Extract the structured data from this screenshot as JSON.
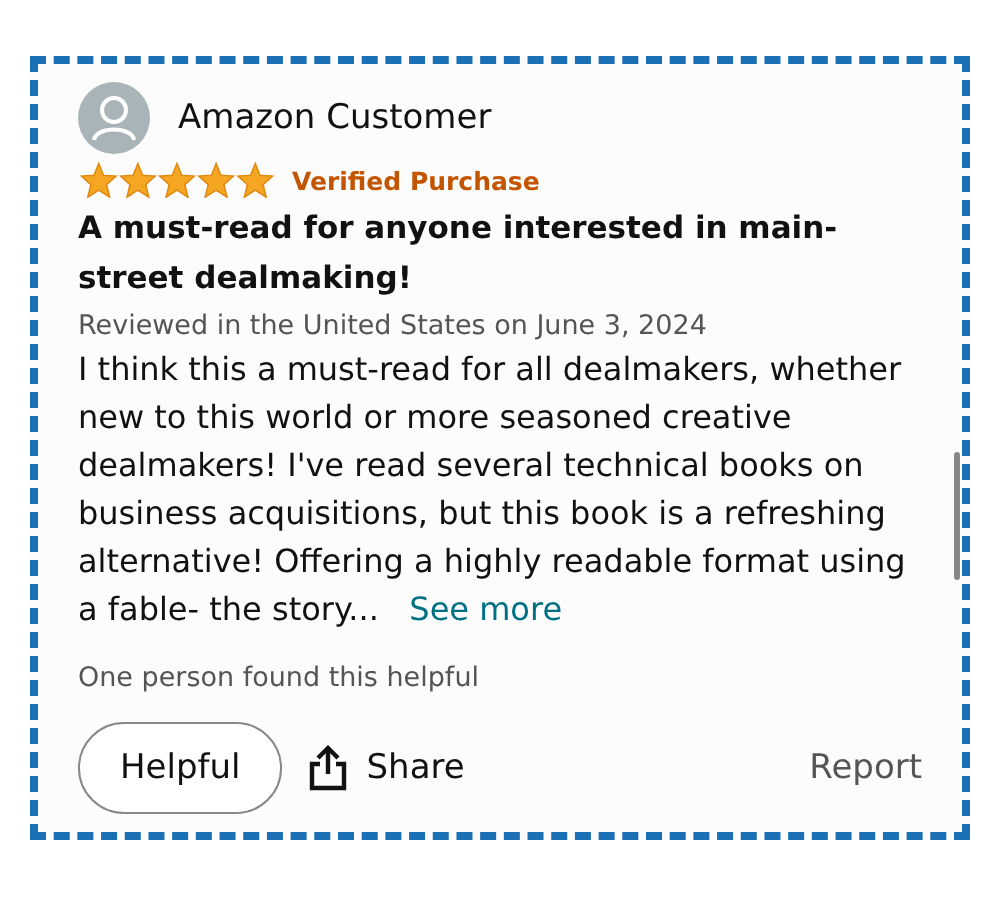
{
  "review": {
    "reviewer": "Amazon Customer",
    "stars": 5,
    "badge": "Verified Purchase",
    "title": "A must-read for anyone interested in main-street dealmaking!",
    "date": "Reviewed in the United States on June 3, 2024",
    "body": "I think this a must-read for all dealmakers, whether new to this world or more seasoned creative dealmakers! I've read several technical books on business acquisitions, but this book is a refreshing alternative! Offering a highly readable format using a fable- the story...",
    "see_more": "See more",
    "helpful_count": "One person found this helpful",
    "buttons": {
      "helpful": "Helpful",
      "share": "Share",
      "report": "Report"
    }
  }
}
